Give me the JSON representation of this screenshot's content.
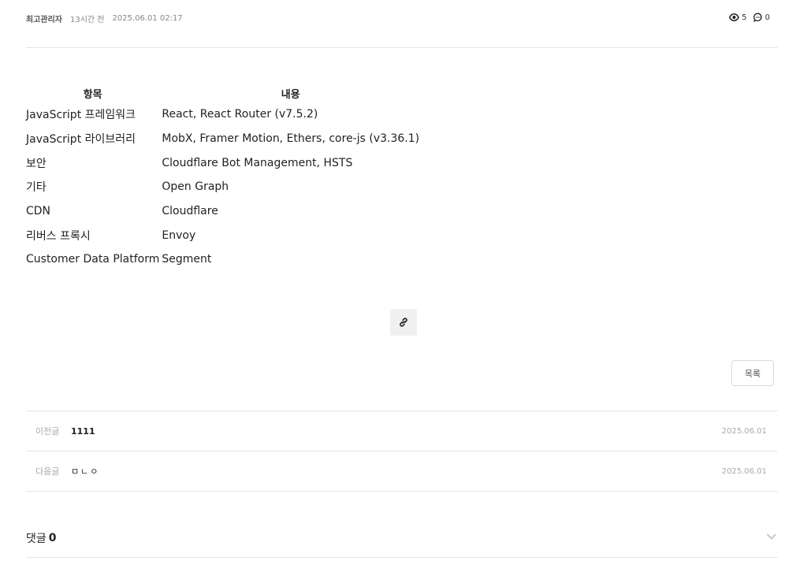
{
  "meta": {
    "author": "최고관리자",
    "ago": "13시간 전",
    "datetime": "2025.06.01 02:17",
    "views": "5",
    "comments": "0"
  },
  "spec_table": {
    "headers": [
      "항목",
      "내용"
    ],
    "rows": [
      {
        "item": "JavaScript 프레임워크",
        "value": "React, React Router (v7.5.2)"
      },
      {
        "item": "JavaScript 라이브러리",
        "value": "MobX, Framer Motion, Ethers, core-js (v3.36.1)"
      },
      {
        "item": "보안",
        "value": "Cloudflare Bot Management, HSTS"
      },
      {
        "item": "기타",
        "value": "Open Graph"
      },
      {
        "item": "CDN",
        "value": "Cloudflare"
      },
      {
        "item": "리버스 프록시",
        "value": "Envoy"
      },
      {
        "item": "Customer Data Platform",
        "value": "Segment"
      }
    ]
  },
  "actions": {
    "list_label": "목록"
  },
  "nav": {
    "prev": {
      "label": "이전글",
      "title": "1111",
      "date": "2025.06.01"
    },
    "next": {
      "label": "다음글",
      "title": "ㅁㄴㅇ",
      "date": "2025.06.01"
    }
  },
  "comments_section": {
    "label": "댓글",
    "count": "0"
  },
  "icons": {
    "views": "eye-icon",
    "comments": "comment-icon",
    "link": "link-icon",
    "toggle": "chevron-down-icon"
  }
}
